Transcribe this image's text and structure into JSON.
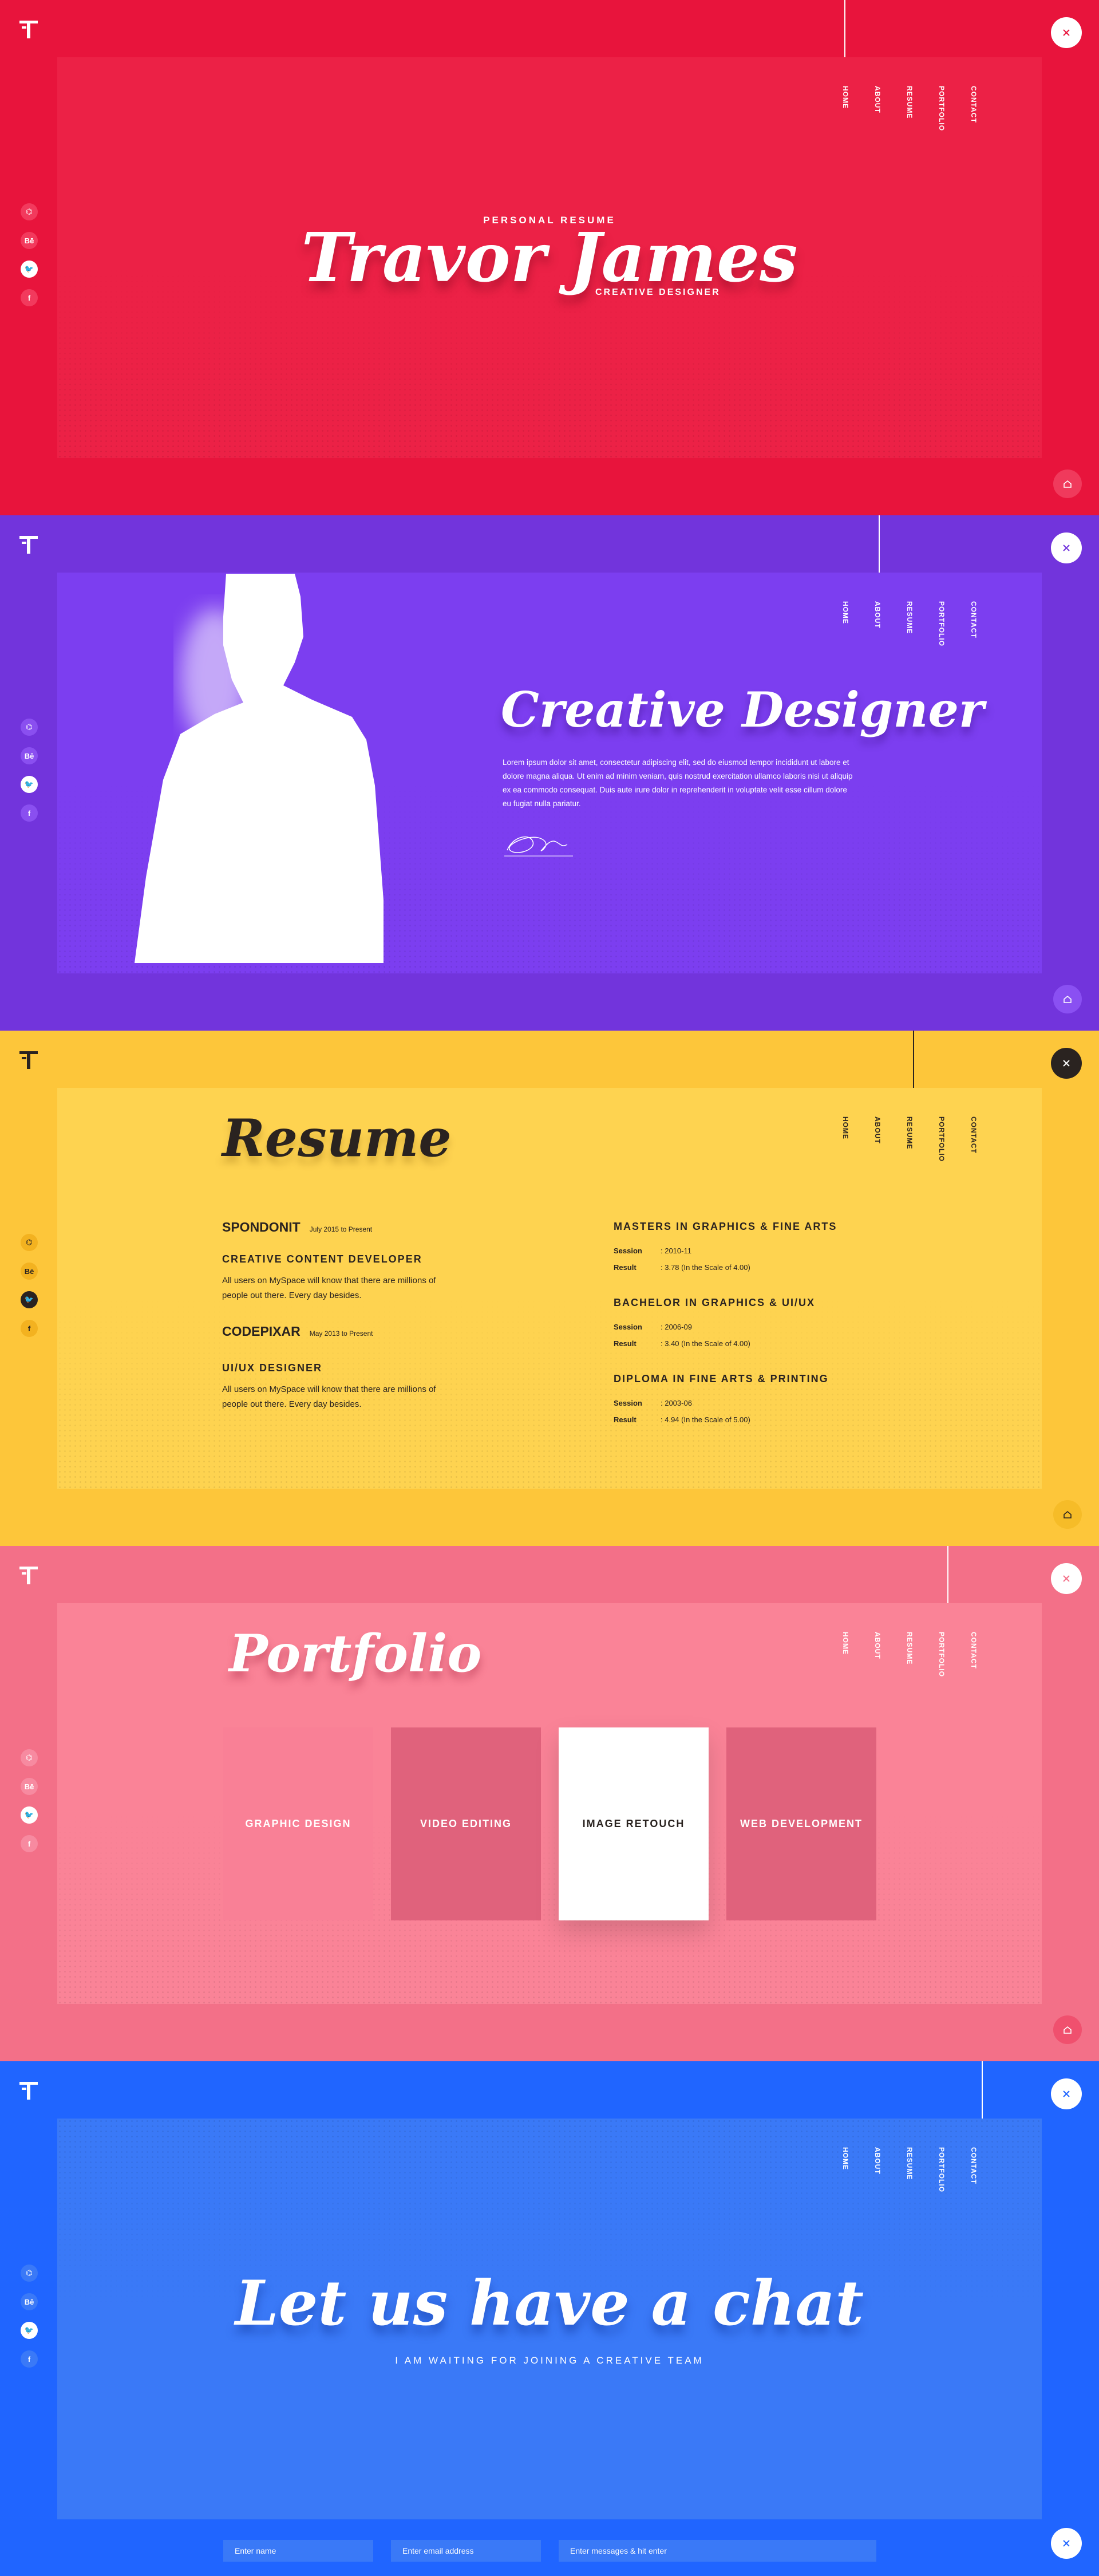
{
  "colors": {
    "red": "#e8143c",
    "purple": "#7234dc",
    "yellow": "#fdc63a",
    "pink": "#f37088",
    "blue": "#2065ff",
    "dark": "#2a2320"
  },
  "nav": [
    "HOME",
    "ABOUT",
    "RESUME",
    "PORTFOLIO",
    "CONTACT"
  ],
  "social_icons": [
    "github-icon",
    "behance-icon",
    "twitter-icon",
    "facebook-icon"
  ],
  "social_glyphs": [
    "⌬",
    "Bē",
    "🐦",
    "f"
  ],
  "hero": {
    "kicker": "PERSONAL RESUME",
    "name": "Travor James",
    "role": "CREATIVE DESIGNER"
  },
  "about": {
    "title": "Creative Designer",
    "text": "Lorem ipsum dolor sit amet, consectetur adipiscing elit, sed do eiusmod tempor incididunt ut labore et dolore magna aliqua. Ut enim ad minim veniam, quis nostrud exercitation ullamco laboris nisi ut aliquip ex ea commodo consequat. Duis aute irure dolor in reprehenderit in voluptate velit esse cillum dolore eu fugiat nulla pariatur."
  },
  "resume": {
    "title": "Resume",
    "jobs": [
      {
        "company": "SPONDONIT",
        "period": "July 2015 to Present",
        "role": "CREATIVE CONTENT DEVELOPER",
        "desc": "All users on MySpace will know that there are millions of people out there. Every day besides."
      },
      {
        "company": "CODEPIXAR",
        "period": "May 2013 to Present",
        "role": "UI/UX DESIGNER",
        "desc": "All users on MySpace will know that there are millions of people out there. Every day besides."
      }
    ],
    "education": [
      {
        "title": "MASTERS IN GRAPHICS & FINE ARTS",
        "session": ": 2010-11",
        "result": ": 3.78 (In the Scale of 4.00)"
      },
      {
        "title": "BACHELOR IN GRAPHICS & UI/UX",
        "session": ": 2006-09",
        "result": ": 3.40 (In the Scale of 4.00)"
      },
      {
        "title": "DIPLOMA IN FINE ARTS & PRINTING",
        "session": ": 2003-06",
        "result": ": 4.94 (In the Scale of 5.00)"
      }
    ],
    "session_label": "Session",
    "result_label": "Result"
  },
  "portfolio": {
    "title": "Portfolio",
    "items": [
      "GRAPHIC DESIGN",
      "VIDEO EDITING",
      "IMAGE RETOUCH",
      "WEB DEVELOPMENT"
    ]
  },
  "contact": {
    "title": "Let us have a chat",
    "subtitle": "I AM WAITING FOR JOINING A CREATIVE TEAM",
    "name_placeholder": "Enter name",
    "email_placeholder": "Enter email address",
    "message_placeholder": "Enter messages & hit enter"
  }
}
